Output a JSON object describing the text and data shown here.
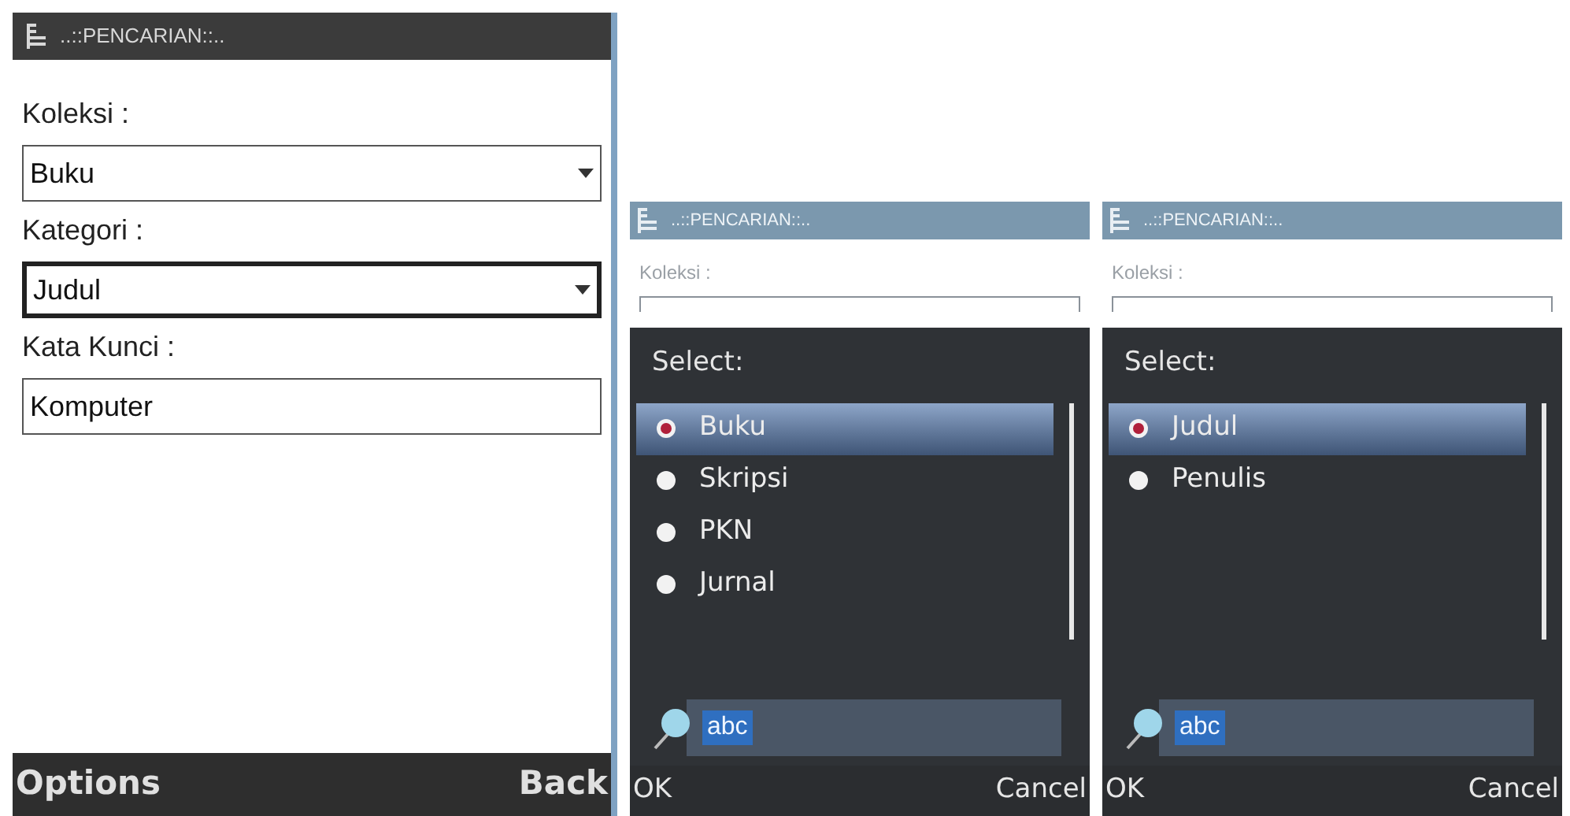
{
  "main_screen": {
    "title": "..::PENCARIAN::..",
    "fields": [
      {
        "label": "Koleksi :",
        "kind": "dropdown",
        "value": "Buku",
        "focused": false
      },
      {
        "label": "Kategori :",
        "kind": "dropdown",
        "value": "Judul",
        "focused": true
      },
      {
        "label": "Kata Kunci :",
        "kind": "text",
        "value": "Komputer",
        "focused": false
      }
    ],
    "softkeys": {
      "left": "Options",
      "right": "Back"
    }
  },
  "select_screens": [
    {
      "title": "..::PENCARIAN::..",
      "background_label": "Koleksi :",
      "dialog_title": "Select:",
      "options": [
        {
          "label": "Buku",
          "selected": true
        },
        {
          "label": "Skripsi",
          "selected": false
        },
        {
          "label": "PKN",
          "selected": false
        },
        {
          "label": "Jurnal",
          "selected": false
        }
      ],
      "search": {
        "value": "abc"
      },
      "softkeys": {
        "left": "OK",
        "right": "Cancel"
      }
    },
    {
      "title": "..::PENCARIAN::..",
      "background_label": "Koleksi :",
      "dialog_title": "Select:",
      "options": [
        {
          "label": "Judul",
          "selected": true
        },
        {
          "label": "Penulis",
          "selected": false
        }
      ],
      "search": {
        "value": "abc"
      },
      "softkeys": {
        "left": "OK",
        "right": "Cancel"
      }
    }
  ]
}
